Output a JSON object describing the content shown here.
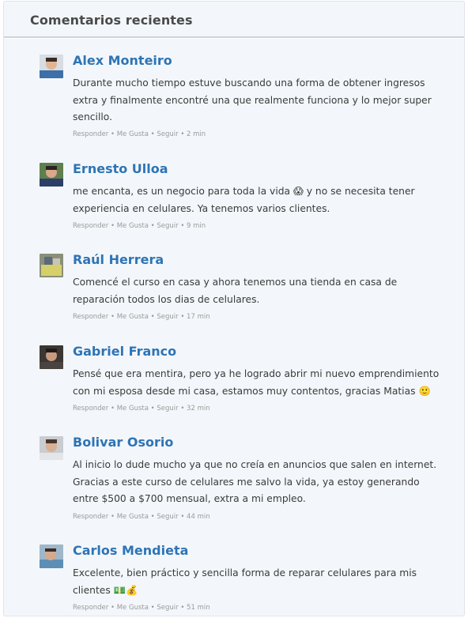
{
  "widget": {
    "title": "Comentarios recientes"
  },
  "action_labels": {
    "reply": "Responder",
    "like": "Me Gusta",
    "follow": "Seguir",
    "sep": " • "
  },
  "comments": [
    {
      "author": "Alex Monteiro",
      "text": "Durante mucho tiempo estuve buscando una forma de obtener ingresos extra y finalmente encontré una que realmente funciona y lo mejor super sencillo.",
      "time": "2 min"
    },
    {
      "author": "Ernesto Ulloa",
      "text": "me encanta, es un negocio para toda la vida 😱 y no se necesita tener experiencia en celulares. Ya tenemos varios clientes.",
      "time": "9 min"
    },
    {
      "author": "Raúl Herrera",
      "text": "Comencé el curso en casa y ahora tenemos una tienda en casa de reparación todos los dias de celulares.",
      "time": "17 min"
    },
    {
      "author": "Gabriel Franco",
      "text": "Pensé que era mentira, pero ya he logrado abrir mi nuevo emprendimiento con mi esposa desde mi casa, estamos muy contentos, gracias Matias 🙂",
      "time": "32 min"
    },
    {
      "author": "Bolivar Osorio",
      "text": "Al inicio lo dude mucho ya que no creía en anuncios que salen en internet. Gracias a este curso de celulares me salvo la vida, ya estoy generando entre $500 a $700 mensual, extra a mi empleo.",
      "time": "44 min"
    },
    {
      "author": "Carlos Mendieta",
      "text": "Excelente, bien práctico y sencilla forma de reparar celulares para mis clientes 💵💰",
      "time": "51 min"
    }
  ],
  "colors": {
    "author": "#2e74b5",
    "panel_bg": "#f3f7fb",
    "meta": "#9a9a9a"
  }
}
